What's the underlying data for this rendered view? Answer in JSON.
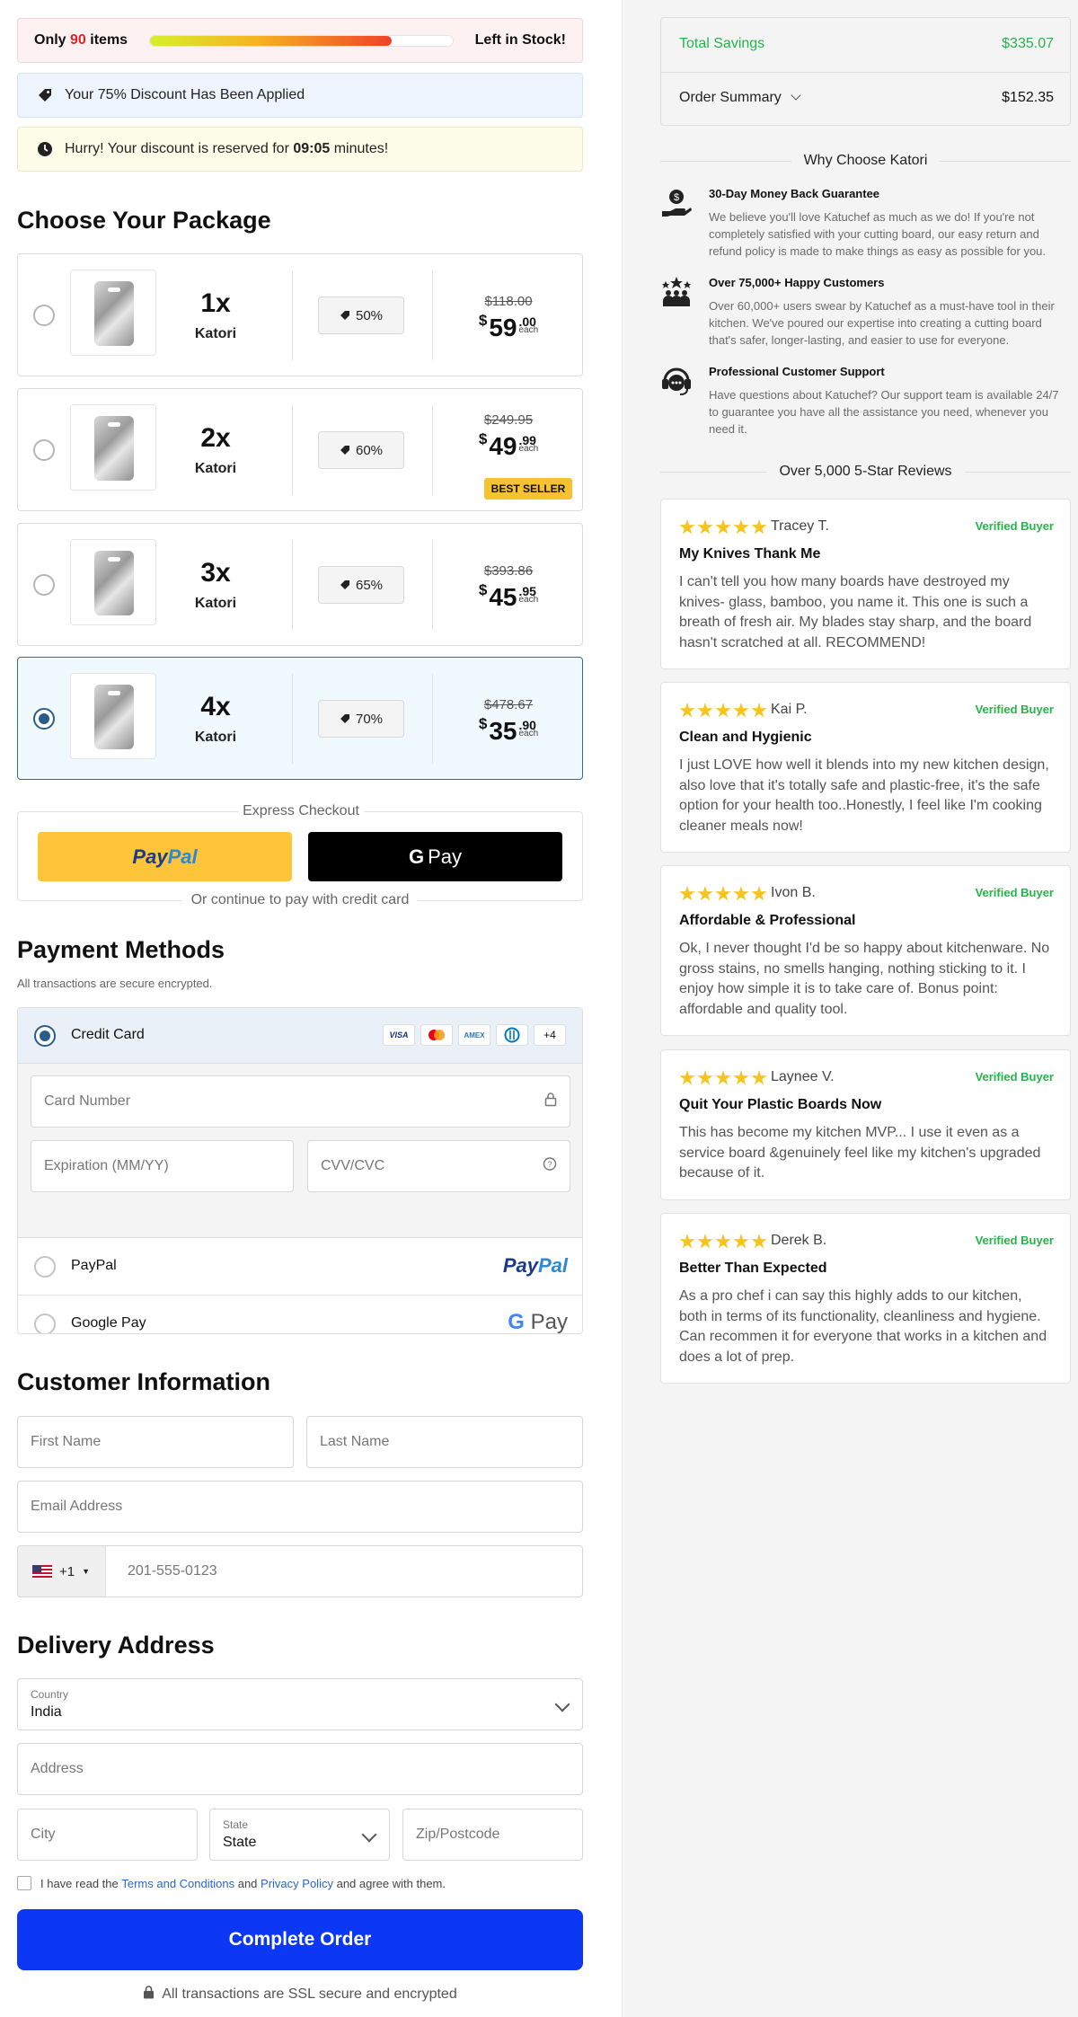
{
  "stock": {
    "prefix": "Only",
    "count": "90",
    "suffix": "items",
    "level": 0.8,
    "right": "Left in Stock!"
  },
  "discount_notice": "Your 75% Discount Has Been Applied",
  "timer": {
    "before": "Hurry! Your discount is reserved for",
    "time": "09:05",
    "after": "minutes!"
  },
  "packages": {
    "title": "Choose Your Package",
    "items": [
      {
        "qty": "1x",
        "name": "Katori",
        "discount": "50%",
        "old": "$118.00",
        "cur": "$",
        "whole": "59",
        "cents": ".00",
        "each": "each",
        "badge": "",
        "selected": false
      },
      {
        "qty": "2x",
        "name": "Katori",
        "discount": "60%",
        "old": "$249.95",
        "cur": "$",
        "whole": "49",
        "cents": ".99",
        "each": "each",
        "badge": "BEST SELLER",
        "selected": false
      },
      {
        "qty": "3x",
        "name": "Katori",
        "discount": "65%",
        "old": "$393.86",
        "cur": "$",
        "whole": "45",
        "cents": ".95",
        "each": "each",
        "badge": "",
        "selected": false
      },
      {
        "qty": "4x",
        "name": "Katori",
        "discount": "70%",
        "old": "$478.67",
        "cur": "$",
        "whole": "35",
        "cents": ".90",
        "each": "each",
        "badge": "",
        "selected": true
      }
    ]
  },
  "express": {
    "label": "Express Checkout",
    "paypal_a": "Pay",
    "paypal_b": "Pal",
    "gpay_g": "G",
    "gpay_pay": "Pay",
    "continue": "Or continue to pay with credit card"
  },
  "payment": {
    "title": "Payment Methods",
    "note": "All transactions are secure encrypted.",
    "credit_card": "Credit Card",
    "cards": [
      "VISA",
      "MC",
      "AMEX",
      "DC",
      "+4"
    ],
    "card_number": "Card Number",
    "expiration": "Expiration (MM/YY)",
    "cvv": "CVV/CVC",
    "paypal": "PayPal",
    "google_pay": "Google Pay",
    "paypal_logo_a": "Pay",
    "paypal_logo_b": "Pal",
    "gpay_logo_g": "G",
    "gpay_logo_pay": "Pay"
  },
  "customer": {
    "title": "Customer Information",
    "first_name": "First Name",
    "last_name": "Last Name",
    "email": "Email Address",
    "dial_code": "+1",
    "phone": "201-555-0123"
  },
  "delivery": {
    "title": "Delivery Address",
    "country_label": "Country",
    "country_value": "India",
    "address": "Address",
    "city": "City",
    "state_label": "State",
    "state_value": "State",
    "zip": "Zip/Postcode"
  },
  "terms": {
    "a": "I have read the",
    "terms_link": "Terms and Conditions",
    "and": "and",
    "privacy_link": "Privacy Policy",
    "b": "and agree with them."
  },
  "complete_button": "Complete Order",
  "ssl_note": "All transactions are SSL secure and encrypted",
  "summary": {
    "savings_label": "Total Savings",
    "savings_value": "$335.07",
    "order_label": "Order Summary",
    "order_value": "$152.35"
  },
  "why": {
    "title": "Why Choose Katori",
    "items": [
      {
        "icon": "money-hand-icon",
        "title": "30-Day Money Back Guarantee",
        "text": "We believe you'll love Katuchef as much as we do! If you're not completely satisfied with your cutting board, our easy return and refund policy is made to make things as easy as possible for you."
      },
      {
        "icon": "customers-icon",
        "title": "Over 75,000+ Happy Customers",
        "text": "Over 60,000+ users swear by Katuchef as a must-have tool in their kitchen. We've poured our expertise into creating a cutting board that's safer, longer-lasting, and easier to use for everyone."
      },
      {
        "icon": "support-headset-icon",
        "title": "Professional Customer Support",
        "text": "Have questions about Katuchef? Our support team is available 24/7 to guarantee you have all the assistance you need, whenever you need it."
      }
    ]
  },
  "reviews": {
    "title": "Over 5,000 5-Star Reviews",
    "verified": "Verified Buyer",
    "items": [
      {
        "name": "Tracey T.",
        "title": "My Knives Thank Me",
        "text": "I can't tell you how many boards have destroyed my knives- glass, bamboo, you name it. This one is such a breath of fresh air. My blades stay sharp, and the board hasn't scratched at all. RECOMMEND!"
      },
      {
        "name": "Kai P.",
        "title": "Clean and Hygienic",
        "text": "I just LOVE how well it blends into my new kitchen design, also love that it's totally safe and plastic-free, it's the safe option for your health too..Honestly, I feel like I'm cooking cleaner meals now!"
      },
      {
        "name": "Ivon B.",
        "title": "Affordable & Professional",
        "text": "Ok, I never thought I'd be so happy about kitchenware. No gross stains, no smells hanging, nothing sticking to it. I enjoy how simple it is to take care of. Bonus point: affordable and quality tool."
      },
      {
        "name": "Laynee V.",
        "title": "Quit Your Plastic Boards Now",
        "text": "This has become my kitchen MVP... I use it even as a service board &genuinely feel like my kitchen's upgraded because of it."
      },
      {
        "name": "Derek B.",
        "title": "Better Than Expected",
        "text": "As a pro chef i can say this highly adds to our kitchen, both in terms of its functionality, cleanliness and hygiene. Can recommen it for everyone that works in a kitchen and does a lot of prep."
      }
    ]
  }
}
